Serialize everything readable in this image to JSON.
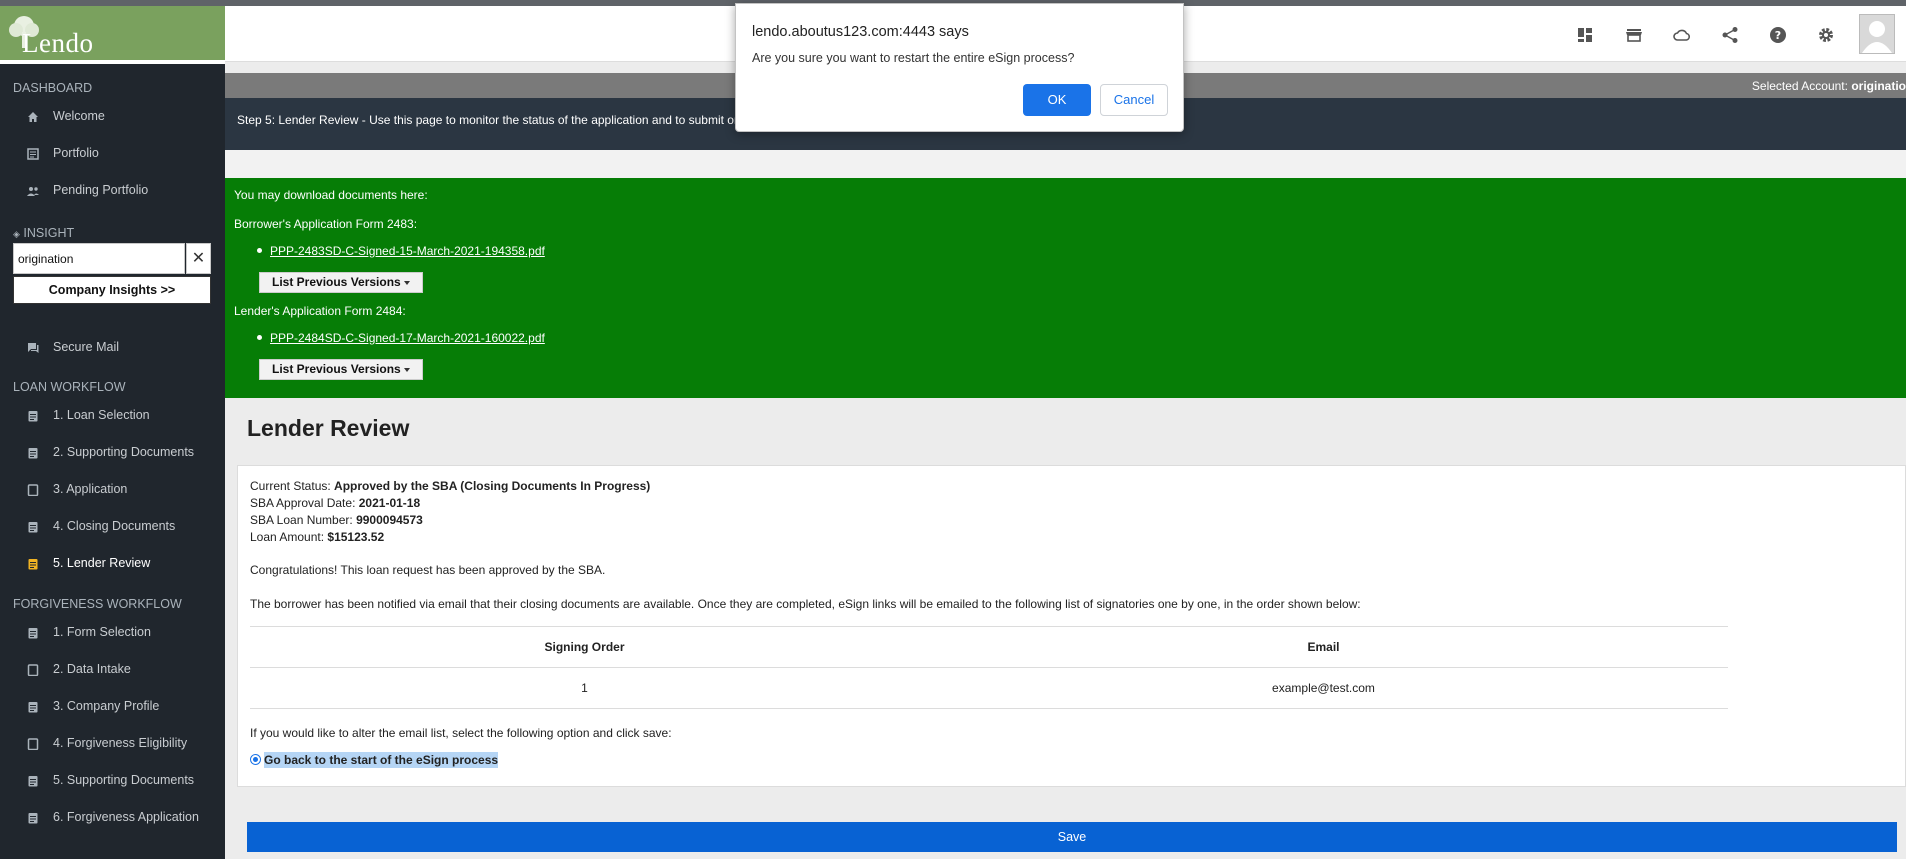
{
  "brand": {
    "logo_text": "Lendo"
  },
  "sidebar": {
    "dashboard_heading": "DASHBOARD",
    "dashboard_items": [
      {
        "label": "Welcome",
        "icon": "home-icon"
      },
      {
        "label": "Portfolio",
        "icon": "portfolio-icon"
      },
      {
        "label": "Pending Portfolio",
        "icon": "people-icon"
      }
    ],
    "insight_heading": "INSIGHT",
    "search_value": "origination",
    "company_insights_label": "Company Insights >>",
    "secure_mail_label": "Secure Mail",
    "loan_heading": "LOAN WORKFLOW",
    "loan_items": [
      {
        "label": "1. Loan Selection"
      },
      {
        "label": "2. Supporting Documents"
      },
      {
        "label": "3. Application"
      },
      {
        "label": "4. Closing Documents"
      },
      {
        "label": "5. Lender Review",
        "active": true
      }
    ],
    "forgiveness_heading": "FORGIVENESS WORKFLOW",
    "forgiveness_items": [
      {
        "label": "1. Form Selection"
      },
      {
        "label": "2. Data Intake"
      },
      {
        "label": "3. Company Profile"
      },
      {
        "label": "4. Forgiveness Eligibility"
      },
      {
        "label": "5. Supporting Documents"
      },
      {
        "label": "6. Forgiveness Application"
      }
    ]
  },
  "header": {
    "icons": [
      "dashboard-grid-icon",
      "store-icon",
      "cloud-icon",
      "share-icon",
      "help-icon",
      "settings-gear-icon",
      "user-avatar"
    ]
  },
  "account_bar": {
    "label": "Selected Account:",
    "value": "originatio"
  },
  "step_bar": {
    "text": "Step 5: Lender Review - Use this page to monitor the status of the application and to submit or c"
  },
  "downloads": {
    "intro": "You may download documents here:",
    "borrower_heading": "Borrower's Application Form 2483:",
    "borrower_file": "PPP-2483SD-C-Signed-15-March-2021-194358.pdf",
    "versions_label": "List Previous Versions",
    "lender_heading": "Lender's Application Form 2484:",
    "lender_file": "PPP-2484SD-C-Signed-17-March-2021-160022.pdf"
  },
  "review": {
    "title": "Lender Review",
    "status_label": "Current Status:",
    "status_value": "Approved by the SBA (Closing Documents In Progress)",
    "approval_date_label": "SBA Approval Date:",
    "approval_date_value": "2021-01-18",
    "loan_number_label": "SBA Loan Number:",
    "loan_number_value": "9900094573",
    "loan_amount_label": "Loan Amount:",
    "loan_amount_value": "$15123.52",
    "congrats": "Congratulations! This loan request has been approved by the SBA.",
    "notice": "The borrower has been notified via email that their closing documents are available. Once they are completed, eSign links will be emailed to the following list of signatories one by one, in the order shown below:",
    "table": {
      "headers": [
        "Signing Order",
        "Email"
      ],
      "rows": [
        [
          "1",
          "example@test.com"
        ]
      ]
    },
    "alter_text": "If you would like to alter the email list, select the following option and click save:",
    "radio_label": "Go back to the start of the eSign process",
    "save_label": "Save"
  },
  "dialog": {
    "title": "lendo.aboutus123.com:4443 says",
    "message": "Are you sure you want to restart the entire eSign process?",
    "ok_label": "OK",
    "cancel_label": "Cancel"
  }
}
